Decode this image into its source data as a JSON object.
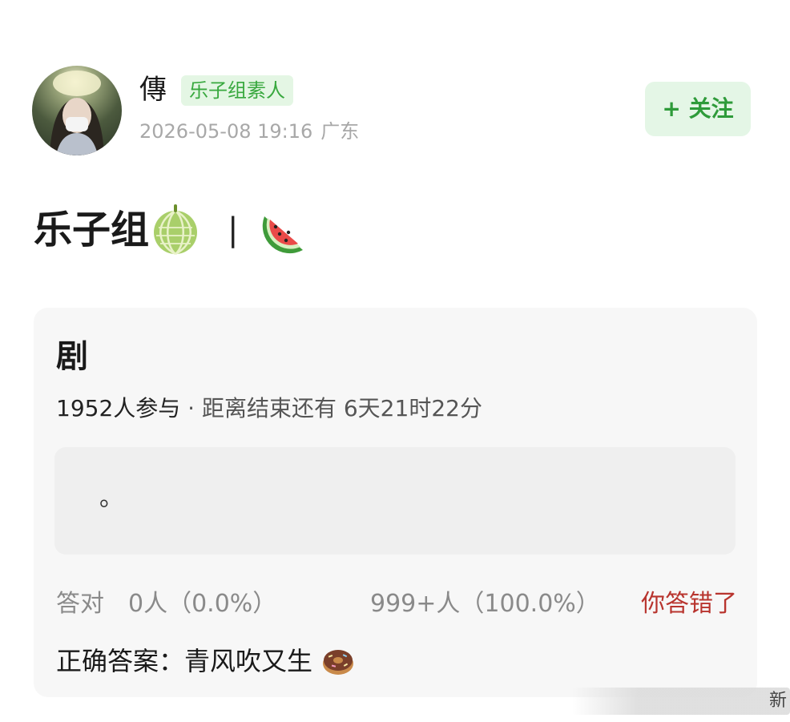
{
  "author": {
    "name": "傳",
    "tag": "乐子组素人",
    "datetime": "2026-05-08 19:16",
    "location": "广东"
  },
  "follow_button": {
    "label": "+ 关注"
  },
  "post": {
    "title_text": "乐子组",
    "separator": "|",
    "title_icons": [
      "melon-icon",
      "watermelon-icon"
    ]
  },
  "quiz": {
    "title": "剧",
    "participants": "1952人参与",
    "dot": " · ",
    "time_left": "距离结束还有 6天21时22分",
    "option_text": "。",
    "correct_label": "答对",
    "correct_stat": "0人（0.0%）",
    "wrong_stat": "999+人（100.0%）",
    "verdict": "你答错了",
    "answer": "正确答案：青风吹又生",
    "answer_icon": "donut-icon"
  },
  "watermark": {
    "text": "新"
  },
  "colors": {
    "tag_green": "#38a83e",
    "follow_green": "#2e9b3a",
    "wrong_red": "#b8342e",
    "meta_gray": "#a8a8a8"
  }
}
